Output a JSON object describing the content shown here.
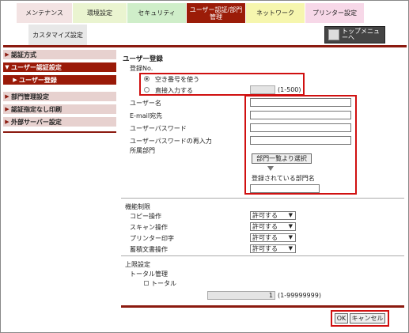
{
  "tabs": [
    {
      "label": "メンテナンス",
      "color": "#f3e3e3"
    },
    {
      "label": "環境設定",
      "color": "#eaf4d0"
    },
    {
      "label": "セキュリティ",
      "color": "#cfeec9"
    },
    {
      "label": "ユーザー認証/部門管理",
      "color": "#9b1c08"
    },
    {
      "label": "ネットワーク",
      "color": "#f6f6ae"
    },
    {
      "label": "プリンター設定",
      "color": "#f7d8e8"
    }
  ],
  "customize_label": "カスタマイズ設定",
  "top_menu_label": "トップメニューへ",
  "sidebar": [
    {
      "label": "認証方式"
    },
    {
      "label": "ユーザー認証設定"
    },
    {
      "label": "ユーザー登録"
    },
    {
      "label": "部門管理設定"
    },
    {
      "label": "認証指定なし印刷"
    },
    {
      "label": "外部サーバー設定"
    }
  ],
  "form": {
    "title": "ユーザー登録",
    "reg_no_label": "登録No.",
    "radio_auto": "空き番号を使う",
    "radio_direct": "直接入力する",
    "range_hint": "(1-500)",
    "user_name": "ユーザー名",
    "email": "E-mail宛先",
    "password": "ユーザーパスワード",
    "password_confirm": "ユーザーパスワードの再入力",
    "department": "所属部門",
    "select_dept_btn": "部門一覧より選択",
    "registered_dept": "登録されている部門名"
  },
  "function_limits": {
    "title": "機能制限",
    "rows": [
      {
        "label": "コピー操作",
        "value": "許可する"
      },
      {
        "label": "スキャン操作",
        "value": "許可する"
      },
      {
        "label": "プリンター印字",
        "value": "許可する"
      },
      {
        "label": "蓄積文書操作",
        "value": "許可する"
      }
    ]
  },
  "upper_limit": {
    "title": "上限設定",
    "total_mgmt": "トータル管理",
    "total_checkbox": "トータル",
    "total_value": "1",
    "total_range": "(1-99999999)"
  },
  "buttons": {
    "ok": "OK",
    "cancel": "キャンセル"
  }
}
